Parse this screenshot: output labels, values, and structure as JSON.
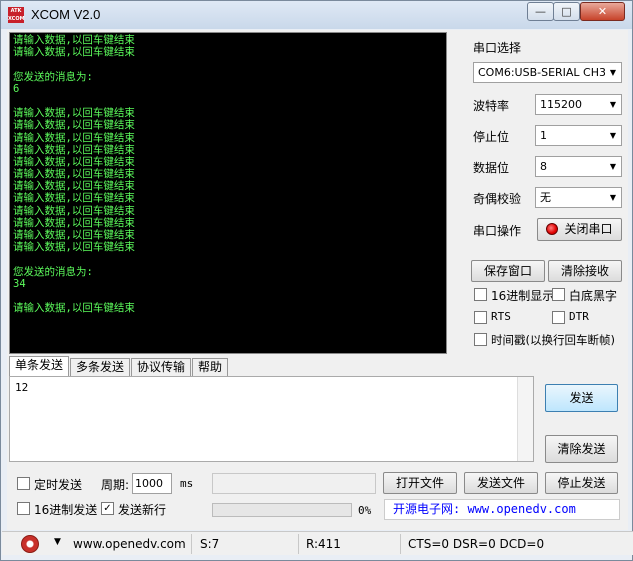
{
  "window": {
    "title": "XCOM V2.0",
    "icon_text": "ATK XCOM",
    "minimize": "—",
    "maximize": "□",
    "close": "✕"
  },
  "console": {
    "lines": [
      "请输入数据,以回车键结束",
      "请输入数据,以回车键结束",
      "",
      "您发送的消息为:",
      "6",
      "",
      "请输入数据,以回车键结束",
      "请输入数据,以回车键结束",
      "请输入数据,以回车键结束",
      "请输入数据,以回车键结束",
      "请输入数据,以回车键结束",
      "请输入数据,以回车键结束",
      "请输入数据,以回车键结束",
      "请输入数据,以回车键结束",
      "请输入数据,以回车键结束",
      "请输入数据,以回车键结束",
      "请输入数据,以回车键结束",
      "请输入数据,以回车键结束",
      "",
      "您发送的消息为:",
      "34",
      "",
      "请输入数据,以回车键结束"
    ]
  },
  "settings": {
    "port_select_label": "串口选择",
    "port_value": "COM6:USB-SERIAL CH340",
    "baud_label": "波特率",
    "baud_value": "115200",
    "stop_label": "停止位",
    "stop_value": "1",
    "data_label": "数据位",
    "data_value": "8",
    "parity_label": "奇偶校验",
    "parity_value": "无",
    "port_op_label": "串口操作",
    "port_op_button": "关闭串口",
    "save_window": "保存窗口",
    "clear_receive": "清除接收",
    "hex_display": "16进制显示",
    "white_bg": "白底黑字",
    "rts": "RTS",
    "dtr": "DTR",
    "timestamp": "时间戳(以换行回车断帧)"
  },
  "tabs": [
    "单条发送",
    "多条发送",
    "协议传输",
    "帮助"
  ],
  "send": {
    "text": "12",
    "send_button": "发送",
    "clear_send_button": "清除发送",
    "timed_send": "定时发送",
    "period_label": "周期:",
    "period_value": "1000",
    "period_unit": "ms",
    "open_file": "打开文件",
    "send_file": "发送文件",
    "stop_send": "停止发送",
    "hex_send": "16进制发送",
    "newline": "发送新行",
    "newline_checked": "✓",
    "progress_percent": 0,
    "progress_text": "0%",
    "link_text": "开源电子网: www.openedv.com"
  },
  "statusbar": {
    "url": "www.openedv.com",
    "sent": "S:7",
    "received": "R:411",
    "lines": "CTS=0 DSR=0 DCD=0"
  }
}
